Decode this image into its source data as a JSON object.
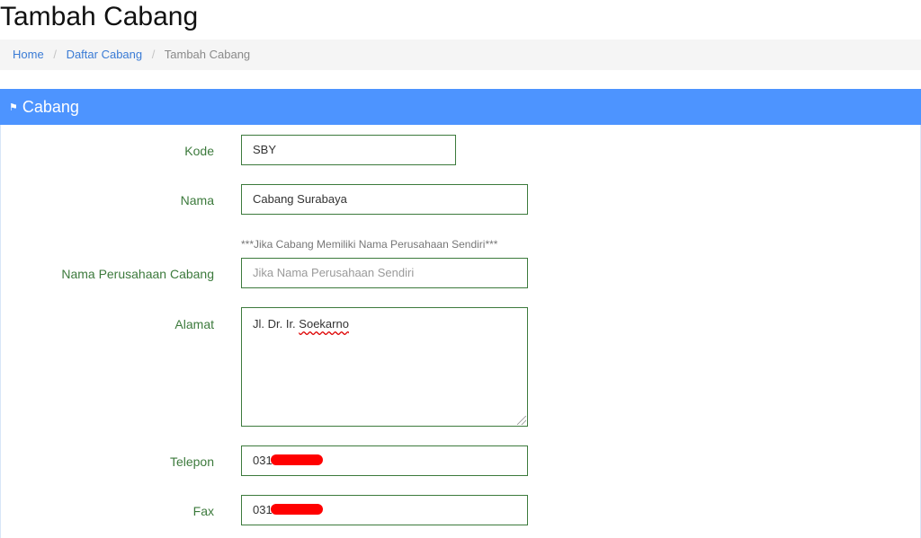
{
  "page": {
    "title": "Tambah Cabang"
  },
  "breadcrumb": {
    "items": [
      {
        "label": "Home"
      },
      {
        "label": "Daftar Cabang"
      }
    ],
    "active": "Tambah Cabang",
    "separator": "/"
  },
  "panel": {
    "title": "Cabang",
    "icon": "flag-icon",
    "header_color": "#4d94ff"
  },
  "form": {
    "kode": {
      "label": "Kode",
      "value": "SBY"
    },
    "nama": {
      "label": "Nama",
      "value": "Cabang Surabaya"
    },
    "perusahaan": {
      "hint": "***Jika Cabang Memiliki Nama Perusahaan Sendiri***",
      "label": "Nama Perusahaan Cabang",
      "placeholder": "Jika Nama Perusahaan Sendiri"
    },
    "alamat": {
      "label": "Alamat",
      "value_prefix": "Jl. Dr. Ir. ",
      "value_word": "Soekarno"
    },
    "telepon": {
      "label": "Telepon",
      "value": "031"
    },
    "fax": {
      "label": "Fax",
      "value": "031"
    }
  },
  "colors": {
    "label_green": "#3c7a3c",
    "link_blue": "#3a7bd5",
    "redaction": "#ff0000"
  }
}
